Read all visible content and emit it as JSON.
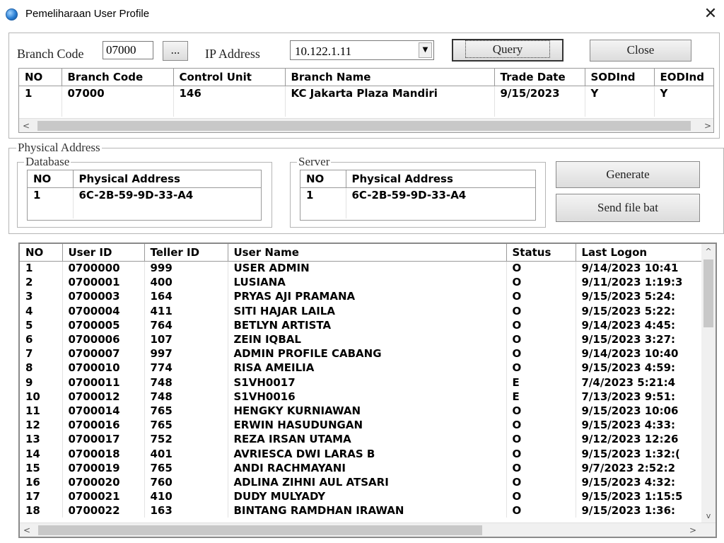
{
  "window": {
    "title": "Pemeliharaan User Profile"
  },
  "query_bar": {
    "branch_code_label": "Branch Code",
    "branch_code_value": "07000",
    "browse_label": "...",
    "ip_label": "IP Address",
    "ip_value": "10.122.1.11",
    "query_label": "Query",
    "close_label": "Close"
  },
  "branch_table": {
    "columns": [
      "NO",
      "Branch Code",
      "Control Unit",
      "Branch Name",
      "Trade Date",
      "SODInd",
      "EODInd"
    ],
    "rows": [
      [
        "1",
        "07000",
        "146",
        "KC Jakarta Plaza Mandiri",
        "9/15/2023",
        "Y",
        "Y"
      ]
    ]
  },
  "physical_address": {
    "group_label": "Physical Address",
    "database": {
      "label": "Database",
      "columns": [
        "NO",
        "Physical Address"
      ],
      "rows": [
        [
          "1",
          "6C-2B-59-9D-33-A4"
        ]
      ]
    },
    "server": {
      "label": "Server",
      "columns": [
        "NO",
        "Physical Address"
      ],
      "rows": [
        [
          "1",
          "6C-2B-59-9D-33-A4"
        ]
      ]
    },
    "generate_label": "Generate",
    "send_label": "Send file bat"
  },
  "user_table": {
    "columns": [
      "NO",
      "User ID",
      "Teller ID",
      "User Name",
      "Status",
      "Last Logon"
    ],
    "rows": [
      [
        "1",
        "0700000",
        "999",
        "USER ADMIN",
        "O",
        "9/14/2023 10:41"
      ],
      [
        "2",
        "0700001",
        "400",
        "LUSIANA",
        "O",
        "9/11/2023 1:19:3"
      ],
      [
        "3",
        "0700003",
        "164",
        "PRYAS AJI PRAMANA",
        "O",
        "9/15/2023 5:24:"
      ],
      [
        "4",
        "0700004",
        "411",
        "SITI HAJAR LAILA",
        "O",
        "9/15/2023 5:22:"
      ],
      [
        "5",
        "0700005",
        "764",
        "BETLYN ARTISTA",
        "O",
        "9/14/2023 4:45:"
      ],
      [
        "6",
        "0700006",
        "107",
        "ZEIN IQBAL",
        "O",
        "9/15/2023 3:27:"
      ],
      [
        "7",
        "0700007",
        "997",
        "ADMIN PROFILE CABANG",
        "O",
        "9/14/2023 10:40"
      ],
      [
        "8",
        "0700010",
        "774",
        "RISA AMEILIA",
        "O",
        "9/15/2023 4:59:"
      ],
      [
        "9",
        "0700011",
        "748",
        "S1VH0017",
        "E",
        "7/4/2023 5:21:4"
      ],
      [
        "10",
        "0700012",
        "748",
        "S1VH0016",
        "E",
        "7/13/2023 9:51:"
      ],
      [
        "11",
        "0700014",
        "765",
        "HENGKY KURNIAWAN",
        "O",
        "9/15/2023 10:06"
      ],
      [
        "12",
        "0700016",
        "765",
        "ERWIN HASUDUNGAN",
        "O",
        "9/15/2023 4:33:"
      ],
      [
        "13",
        "0700017",
        "752",
        "REZA IRSAN UTAMA",
        "O",
        "9/12/2023 12:26"
      ],
      [
        "14",
        "0700018",
        "401",
        "AVRIESCA DWI LARAS B",
        "O",
        "9/15/2023 1:32:("
      ],
      [
        "15",
        "0700019",
        "765",
        "ANDI RACHMAYANI",
        "O",
        "9/7/2023 2:52:2"
      ],
      [
        "16",
        "0700020",
        "760",
        "ADLINA ZIHNI AUL ATSARI",
        "O",
        "9/15/2023 4:32:"
      ],
      [
        "17",
        "0700021",
        "410",
        "DUDY MULYADY",
        "O",
        "9/15/2023 1:15:5"
      ],
      [
        "18",
        "0700022",
        "163",
        "BINTANG RAMDHAN IRAWAN",
        "O",
        "9/15/2023 1:36:"
      ]
    ]
  },
  "icons": {
    "app": "app-globe-icon",
    "close": "close-icon",
    "dropdown": "chevron-down-icon",
    "scroll_left": "chevron-left-icon",
    "scroll_right": "chevron-right-icon",
    "scroll_up": "chevron-up-icon",
    "scroll_down": "chevron-down-icon"
  }
}
